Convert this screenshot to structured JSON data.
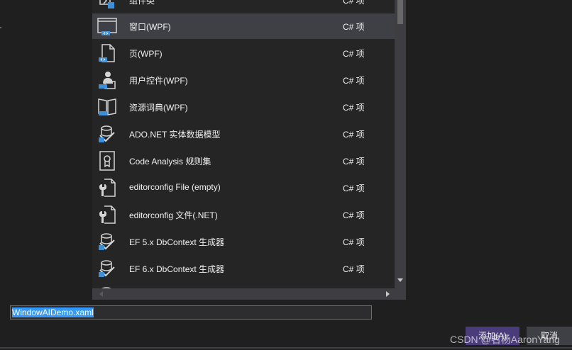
{
  "dialog": {
    "item_list": {
      "items": [
        {
          "name": "组件类",
          "type": "C# 项",
          "icon": "component-class-icon",
          "selected": false
        },
        {
          "name": "窗口(WPF)",
          "type": "C# 项",
          "icon": "wpf-window-icon",
          "selected": true
        },
        {
          "name": "页(WPF)",
          "type": "C# 项",
          "icon": "wpf-page-icon",
          "selected": false
        },
        {
          "name": "用户控件(WPF)",
          "type": "C# 项",
          "icon": "wpf-user-control-icon",
          "selected": false
        },
        {
          "name": "资源词典(WPF)",
          "type": "C# 项",
          "icon": "wpf-resource-dictionary-icon",
          "selected": false
        },
        {
          "name": "ADO.NET 实体数据模型",
          "type": "C# 项",
          "icon": "entity-data-model-icon",
          "selected": false
        },
        {
          "name": "Code Analysis 规则集",
          "type": "C# 项",
          "icon": "rule-set-icon",
          "selected": false
        },
        {
          "name": "editorconfig File (empty)",
          "type": "C# 项",
          "icon": "editorconfig-file-icon",
          "selected": false
        },
        {
          "name": "editorconfig 文件(.NET)",
          "type": "C# 项",
          "icon": "editorconfig-dotnet-icon",
          "selected": false
        },
        {
          "name": "EF 5.x DbContext 生成器",
          "type": "C# 项",
          "icon": "ef-generator-icon",
          "selected": false
        },
        {
          "name": "EF 6.x DbContext 生成器",
          "type": "C# 项",
          "icon": "ef-generator-icon",
          "selected": false
        }
      ]
    },
    "name_field": {
      "value": "WindowAIDemo.xaml"
    },
    "buttons": {
      "add_label": "添加(A)",
      "cancel_label": "取消"
    },
    "watermark": "CSDN @名杨AaronYang"
  },
  "colors": {
    "background": "#1f1f1f",
    "list_background": "#252526",
    "selected_row": "#3f3f46",
    "accent_button": "#4a3c7a",
    "icon_blue": "#3f8fd6",
    "icon_stroke": "#d4d4d4"
  }
}
